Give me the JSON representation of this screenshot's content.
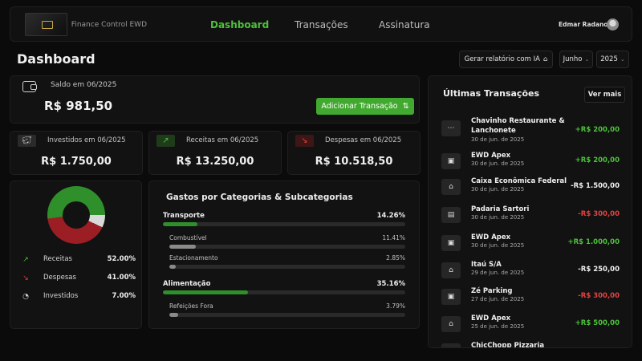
{
  "header": {
    "app_name": "Finance Control EWD",
    "nav": [
      "Dashboard",
      "Transações",
      "Assinatura"
    ],
    "user_name": "Edmar Radanovis"
  },
  "page": {
    "title": "Dashboard",
    "report_button": "Gerar relatório com IA",
    "month": "Junho",
    "year": "2025"
  },
  "saldo": {
    "label": "Saldo em 06/2025",
    "value": "R$ 981,50",
    "add_button": "Adicionar Transação"
  },
  "stats": [
    {
      "label": "Investidos em 06/2025",
      "value": "R$ 1.750,00",
      "icon": "piggy-bank-icon"
    },
    {
      "label": "Receitas em 06/2025",
      "value": "R$ 13.250,00",
      "icon": "trending-up-icon"
    },
    {
      "label": "Despesas em 06/2025",
      "value": "R$ 10.518,50",
      "icon": "trending-down-icon"
    }
  ],
  "distribution": {
    "items": [
      {
        "name": "Receitas",
        "pct": "52.00%",
        "value": 52,
        "color": "#2f8f2a"
      },
      {
        "name": "Despesas",
        "pct": "41.00%",
        "value": 41,
        "color": "#9b1e24"
      },
      {
        "name": "Investidos",
        "pct": "7.00%",
        "value": 7,
        "color": "#d9d9d9"
      }
    ]
  },
  "categories": {
    "title": "Gastos por Categorias & Subcategorias",
    "items": [
      {
        "name": "Transporte",
        "pct": "14.26%",
        "value": 14.26,
        "subs": [
          {
            "name": "Combustível",
            "pct": "11.41%",
            "value": 11.41
          },
          {
            "name": "Estacionamento",
            "pct": "2.85%",
            "value": 2.85
          }
        ]
      },
      {
        "name": "Alimentação",
        "pct": "35.16%",
        "value": 35.16,
        "subs": [
          {
            "name": "Refeições Fora",
            "pct": "3.79%",
            "value": 3.79
          }
        ]
      }
    ]
  },
  "transactions": {
    "title": "Últimas Transações",
    "more_button": "Ver mais",
    "items": [
      {
        "name": "Chavinho Restaurante & Lanchonete",
        "date": "30 de jun. de 2025",
        "amount": "+R$ 200,00",
        "type": "pos",
        "icon": "more-icon"
      },
      {
        "name": "EWD Apex",
        "date": "30 de jun. de 2025",
        "amount": "+R$ 200,00",
        "type": "pos",
        "icon": "cash-icon"
      },
      {
        "name": "Caixa Econômica Federal",
        "date": "30 de jun. de 2025",
        "amount": "-R$ 1.500,00",
        "type": "neg-white",
        "icon": "bank-icon"
      },
      {
        "name": "Padaria Sartori",
        "date": "30 de jun. de 2025",
        "amount": "-R$ 300,00",
        "type": "neg-red",
        "icon": "wallet-icon"
      },
      {
        "name": "EWD Apex",
        "date": "30 de jun. de 2025",
        "amount": "+R$ 1.000,00",
        "type": "pos",
        "icon": "cash-icon"
      },
      {
        "name": "Itaú S/A",
        "date": "29 de jun. de 2025",
        "amount": "-R$ 250,00",
        "type": "neg-white",
        "icon": "bank-icon"
      },
      {
        "name": "Zé Parking",
        "date": "27 de jun. de 2025",
        "amount": "-R$ 300,00",
        "type": "neg-red",
        "icon": "cash-icon"
      },
      {
        "name": "EWD Apex",
        "date": "25 de jun. de 2025",
        "amount": "+R$ 500,00",
        "type": "pos",
        "icon": "bank-icon"
      },
      {
        "name": "ChicChopp Pizzaria",
        "date": "",
        "amount": "",
        "type": "neg-red",
        "icon": "cash-icon"
      }
    ]
  }
}
